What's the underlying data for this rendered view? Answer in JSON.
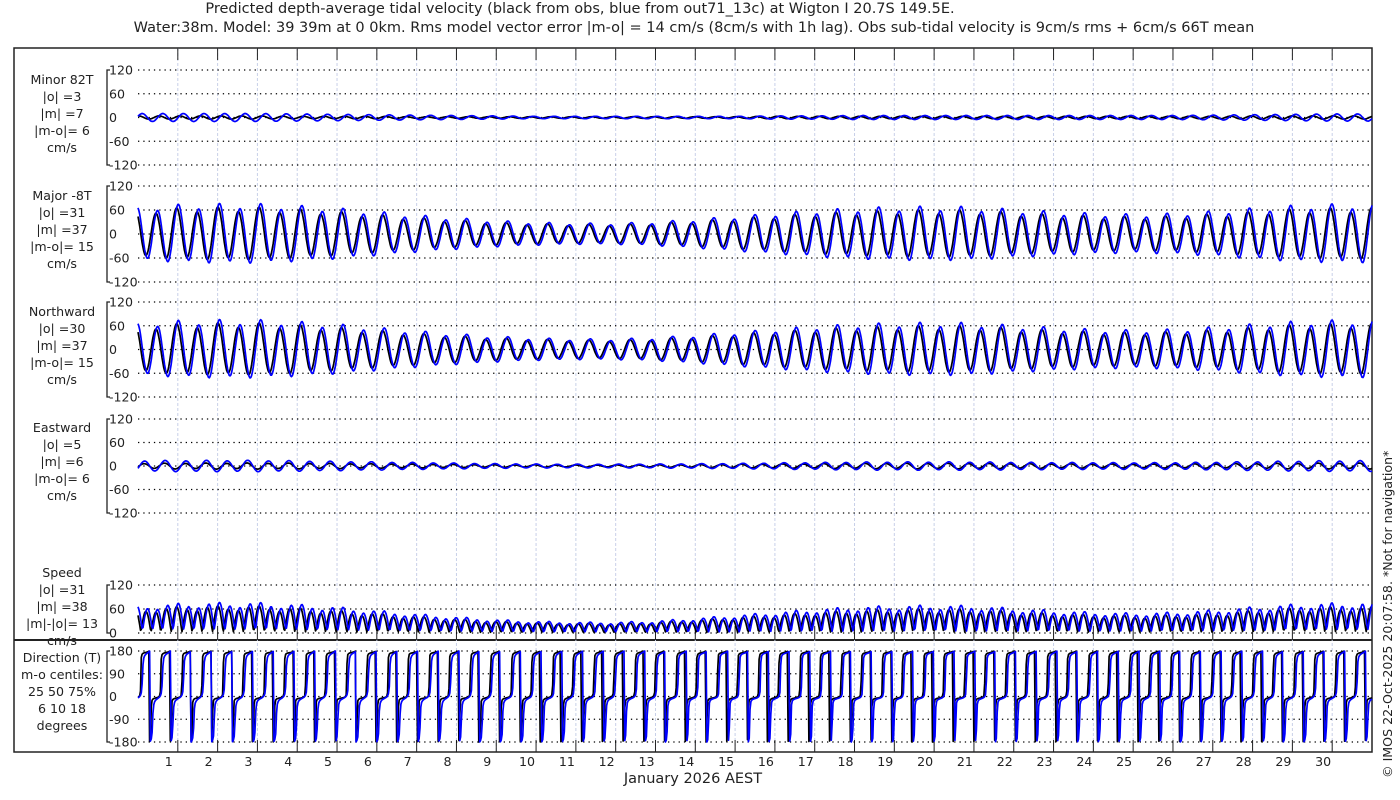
{
  "title": {
    "line1": "Predicted depth-average tidal velocity (black from obs, blue from out71_13c) at Wigton I 20.7S 149.5E.",
    "line2": "Water:38m. Model: 39 39m at 0 0km. Rms model vector error |m-o| = 14 cm/s (8cm/s with 1h lag). Obs sub-tidal velocity is 9cm/s rms + 6cm/s 66T mean"
  },
  "copyright": "© IMOS 22-Oct-2025 20:07:58. *Not for navigation*",
  "colors": {
    "obs": "#000000",
    "model": "#0000ff",
    "grid": "#000000",
    "day_grid": "#c8d0e8"
  },
  "chart_data": {
    "type": "line",
    "xlabel": "January 2026 AEST",
    "x_unit": "day of January 2026",
    "xlim": [
      0,
      31
    ],
    "xticks": [
      1,
      2,
      3,
      4,
      5,
      6,
      7,
      8,
      9,
      10,
      11,
      12,
      13,
      14,
      15,
      16,
      17,
      18,
      19,
      20,
      21,
      22,
      23,
      24,
      25,
      26,
      27,
      28,
      29,
      30
    ],
    "legend": "none (described in title: black = obs, blue = model)",
    "grid": true,
    "tidal_period_hours": 12.42,
    "amplitude_by_day_cm_s": {
      "major_obs": [
        55,
        60,
        62,
        62,
        58,
        52,
        45,
        38,
        32,
        27,
        24,
        22,
        22,
        25,
        30,
        36,
        42,
        48,
        52,
        55,
        56,
        55,
        50,
        45,
        42,
        40,
        42,
        46,
        52,
        58,
        60,
        60
      ],
      "major_model": [
        62,
        68,
        70,
        70,
        66,
        60,
        52,
        44,
        37,
        31,
        27,
        25,
        25,
        28,
        34,
        41,
        48,
        55,
        60,
        63,
        64,
        63,
        57,
        52,
        48,
        46,
        48,
        53,
        60,
        66,
        69,
        69
      ],
      "minor_obs": [
        4,
        4,
        4,
        4,
        3,
        3,
        3,
        2,
        2,
        2,
        2,
        2,
        2,
        2,
        2,
        2,
        3,
        3,
        3,
        3,
        3,
        3,
        3,
        3,
        3,
        3,
        3,
        3,
        4,
        4,
        4,
        4
      ],
      "minor_model": [
        10,
        10,
        10,
        10,
        9,
        8,
        7,
        6,
        5,
        4,
        3,
        3,
        3,
        3,
        3,
        3,
        4,
        4,
        5,
        5,
        5,
        5,
        5,
        5,
        5,
        5,
        5,
        6,
        7,
        8,
        9,
        9
      ]
    },
    "panels": [
      {
        "name": "minor",
        "label": [
          "Minor 82T",
          "|o| =3",
          "|m| =7",
          "|m-o|= 6",
          "cm/s"
        ],
        "ylim": [
          -120,
          120
        ],
        "yticks": [
          120,
          60,
          0,
          -60,
          -120
        ],
        "tick_labels": [
          "120",
          "60",
          "0",
          "-60",
          "-120"
        ]
      },
      {
        "name": "major",
        "label": [
          "Major -8T",
          "|o| =31",
          "|m| =37",
          "|m-o|= 15",
          "cm/s"
        ],
        "ylim": [
          -120,
          120
        ],
        "yticks": [
          120,
          60,
          0,
          -60,
          -120
        ],
        "tick_labels": [
          "120",
          "60",
          "0",
          "-60",
          "-120"
        ]
      },
      {
        "name": "northward",
        "label": [
          "Northward",
          "|o| =30",
          "|m| =37",
          "|m-o|= 15",
          "cm/s"
        ],
        "ylim": [
          -120,
          120
        ],
        "yticks": [
          120,
          60,
          0,
          -60,
          -120
        ],
        "tick_labels": [
          "120",
          "60",
          "0",
          "-60",
          "-120"
        ]
      },
      {
        "name": "eastward",
        "label": [
          "Eastward",
          "|o| =5",
          "|m| =6",
          "|m-o|= 6",
          "cm/s"
        ],
        "ylim": [
          -120,
          120
        ],
        "yticks": [
          120,
          60,
          0,
          -60,
          -120
        ],
        "tick_labels": [
          "120",
          "60",
          "0",
          "-60",
          "-120"
        ]
      },
      {
        "name": "speed",
        "label": [
          "Speed",
          "|o| =31",
          "|m| =38",
          "|m|-|o|= 13",
          "cm/s"
        ],
        "ylim": [
          0,
          120
        ],
        "yticks": [
          120,
          60,
          0
        ],
        "tick_labels": [
          "120",
          "60",
          "0"
        ]
      },
      {
        "name": "direction",
        "label": [
          "Direction (T)",
          "m-o centiles:",
          "25  50  75%",
          "6  10  18",
          "degrees"
        ],
        "ylim": [
          -180,
          180
        ],
        "yticks": [
          180,
          90,
          0,
          -90,
          -180
        ],
        "tick_labels": [
          "180",
          "90",
          "0",
          "-90",
          "-180"
        ]
      }
    ]
  }
}
